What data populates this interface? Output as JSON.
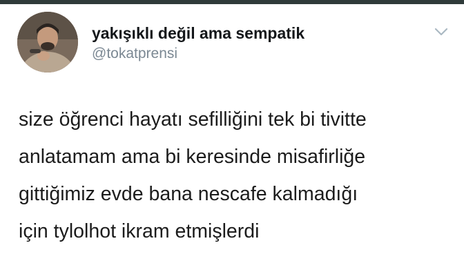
{
  "tweet": {
    "author": {
      "display_name": "yakışıklı değil ama sempatik",
      "handle": "@tokatprensi",
      "avatar_icon": "profile-photo"
    },
    "menu_icon": "chevron-down-icon",
    "text_lines": [
      "size öğrenci hayatı sefilliğini tek bi tivitte",
      "anlatamam ama bi keresinde misafirliğe",
      "gittiğimiz evde bana nescafe kalmadığı",
      "için tylolhot ikram etmişlerdi"
    ]
  },
  "colors": {
    "text": "#14171a",
    "handle": "#7b8893",
    "chevron": "#aab8c2",
    "top_strip": "#2f3b3a"
  }
}
